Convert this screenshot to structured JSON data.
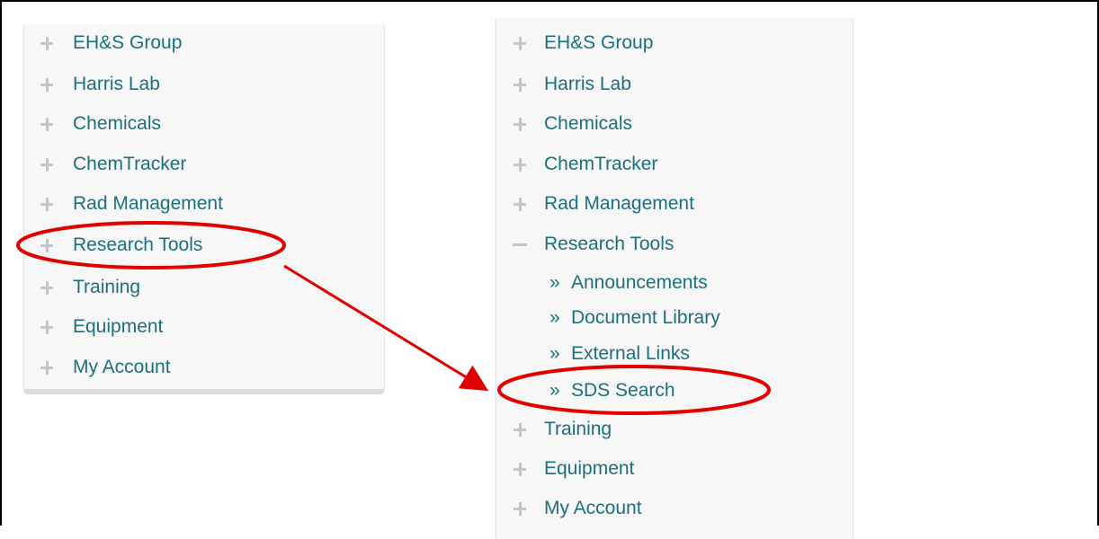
{
  "left_menu": {
    "items": [
      {
        "label": "EH&S Group",
        "expander": "plus"
      },
      {
        "label": "Harris Lab",
        "expander": "plus"
      },
      {
        "label": "Chemicals",
        "expander": "plus"
      },
      {
        "label": "ChemTracker",
        "expander": "plus"
      },
      {
        "label": "Rad Management",
        "expander": "plus"
      },
      {
        "label": "Research Tools",
        "expander": "plus",
        "highlighted": true
      },
      {
        "label": "Training",
        "expander": "plus"
      },
      {
        "label": "Equipment",
        "expander": "plus"
      },
      {
        "label": "My Account",
        "expander": "plus"
      }
    ]
  },
  "right_menu": {
    "items": [
      {
        "label": "EH&S Group",
        "expander": "plus"
      },
      {
        "label": "Harris Lab",
        "expander": "plus"
      },
      {
        "label": "Chemicals",
        "expander": "plus"
      },
      {
        "label": "ChemTracker",
        "expander": "plus"
      },
      {
        "label": "Rad Management",
        "expander": "plus"
      },
      {
        "label": "Research Tools",
        "expander": "minus"
      },
      {
        "label": "Training",
        "expander": "plus"
      },
      {
        "label": "Equipment",
        "expander": "plus"
      },
      {
        "label": "My Account",
        "expander": "plus"
      }
    ],
    "research_tools_subitems": [
      {
        "prefix": "»",
        "label": "Announcements"
      },
      {
        "prefix": "»",
        "label": "Document Library"
      },
      {
        "prefix": "»",
        "label": "External Links"
      },
      {
        "prefix": "»",
        "label": "SDS Search",
        "highlighted": true
      }
    ]
  },
  "annotation": {
    "color": "#e00000",
    "expander_icon_names": {
      "plus": "plus-icon",
      "minus": "minus-icon"
    }
  }
}
